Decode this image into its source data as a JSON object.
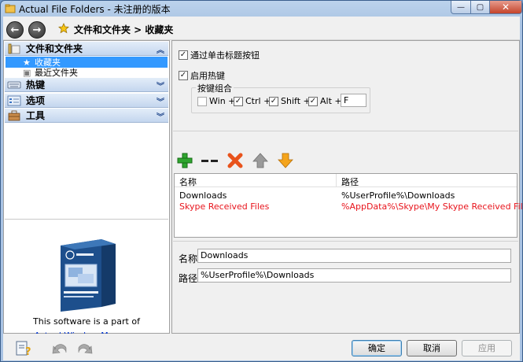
{
  "window": {
    "title": "Actual File Folders - 未注册的版本",
    "caption_min": "—",
    "caption_max": "▢",
    "caption_close": "✕"
  },
  "nav": {
    "back": "←",
    "forward": "→",
    "breadcrumb": "文件和文件夹 > 收藏夹"
  },
  "sidebar": {
    "groups": [
      {
        "label": "文件和文件夹",
        "chevron": "≈",
        "expanded": true,
        "items": [
          {
            "label": "收藏夹",
            "selected": true
          },
          {
            "label": "最近文件夹",
            "selected": false
          }
        ]
      },
      {
        "label": "热键",
        "chevron": "≈",
        "expanded": false
      },
      {
        "label": "选项",
        "chevron": "≈",
        "expanded": false
      },
      {
        "label": "工具",
        "chevron": "≈",
        "expanded": false
      }
    ],
    "promo_text": "This software is a part of",
    "promo_link": "Actual Window Manager"
  },
  "settings": {
    "title_button": {
      "label": "通过单击标题按钮",
      "checked": true
    },
    "enable_hotkey": {
      "label": "启用热键",
      "checked": true
    },
    "hotkey_group_label": "按键组合",
    "modifiers": [
      {
        "label": "Win +",
        "checked": false
      },
      {
        "label": "Ctrl +",
        "checked": true
      },
      {
        "label": "Shift +",
        "checked": true
      },
      {
        "label": "Alt +",
        "checked": true
      }
    ],
    "key_value": "F",
    "check_mark": "✓"
  },
  "toolbar": {
    "add_icon": "add-icon",
    "separator_icon": "separator-icon",
    "delete_icon": "delete-icon",
    "move_up_icon": "arrow-up-icon",
    "move_down_icon": "arrow-down-icon",
    "separator_text": "▬▬"
  },
  "list": {
    "columns": [
      "名称",
      "路径"
    ],
    "rows": [
      {
        "name": "Downloads",
        "path": "%UserProfile%\\Downloads",
        "color": "#000000"
      },
      {
        "name": "Skype Received Files",
        "path": "%AppData%\\Skype\\My Skype Received Files",
        "color": "#e8141c"
      }
    ]
  },
  "details": {
    "name_label": "名称",
    "name_value": "Downloads",
    "path_label": "路径",
    "path_value": "%UserProfile%\\Downloads"
  },
  "buttons": {
    "ok": "确定",
    "cancel": "取消",
    "apply": "应用"
  },
  "colors": {
    "selection": "#3399ff",
    "warning_row": "#e8141c",
    "link": "#0033cc"
  }
}
